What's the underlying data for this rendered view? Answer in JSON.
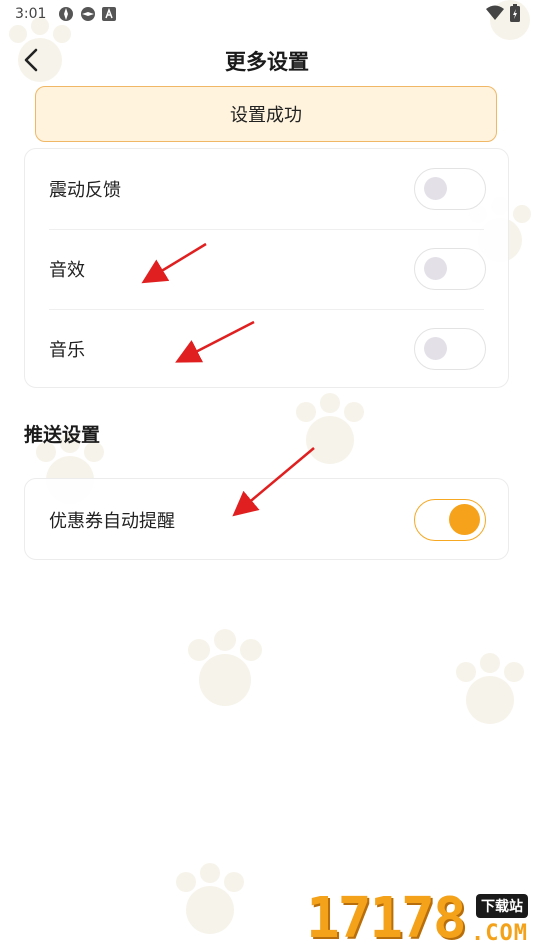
{
  "status_bar": {
    "time": "3:01"
  },
  "header": {
    "title": "更多设置"
  },
  "toast": {
    "text": "设置成功"
  },
  "sound_settings": {
    "items": [
      {
        "label": "震动反馈",
        "enabled": false
      },
      {
        "label": "音效",
        "enabled": false
      },
      {
        "label": "音乐",
        "enabled": false
      }
    ]
  },
  "push_settings": {
    "title": "推送设置",
    "items": [
      {
        "label": "优惠券自动提醒",
        "enabled": true
      }
    ]
  },
  "watermark": {
    "number": "17178",
    "badge": "下载站",
    "domain": ".COM"
  },
  "colors": {
    "accent": "#f6a31b",
    "toast_bg": "#fff3de",
    "toast_border": "#f0b866",
    "arrow": "#e02020"
  }
}
